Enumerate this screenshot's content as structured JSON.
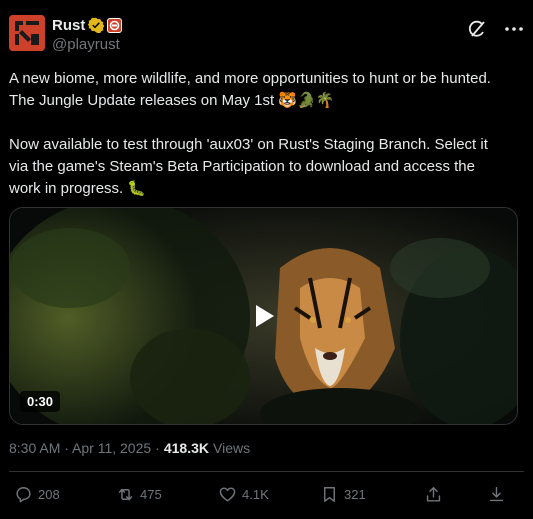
{
  "author": {
    "display_name": "Rust",
    "handle": "@playrust"
  },
  "tweet": {
    "text": "A new biome, more wildlife, and more opportunities to hunt or be hunted. The Jungle Update releases on May 1st 🐯🐊🌴\n\nNow available to test through 'aux03' on Rust's Staging Branch. Select it via the game's Steam's Beta Participation to download and access the work in progress. 🐛"
  },
  "media": {
    "duration": "0:30"
  },
  "meta": {
    "timestamp": "8:30 AM · Apr 11, 2025",
    "separator": "·",
    "views_count": "418.3K",
    "views_label": "Views"
  },
  "actions": {
    "replies": "208",
    "reposts": "475",
    "likes": "4.1K",
    "bookmarks": "321"
  },
  "colors": {
    "brand": "#cd412b",
    "text": "#e7e9ea",
    "muted": "#71767b",
    "verified": "#e2b719"
  }
}
